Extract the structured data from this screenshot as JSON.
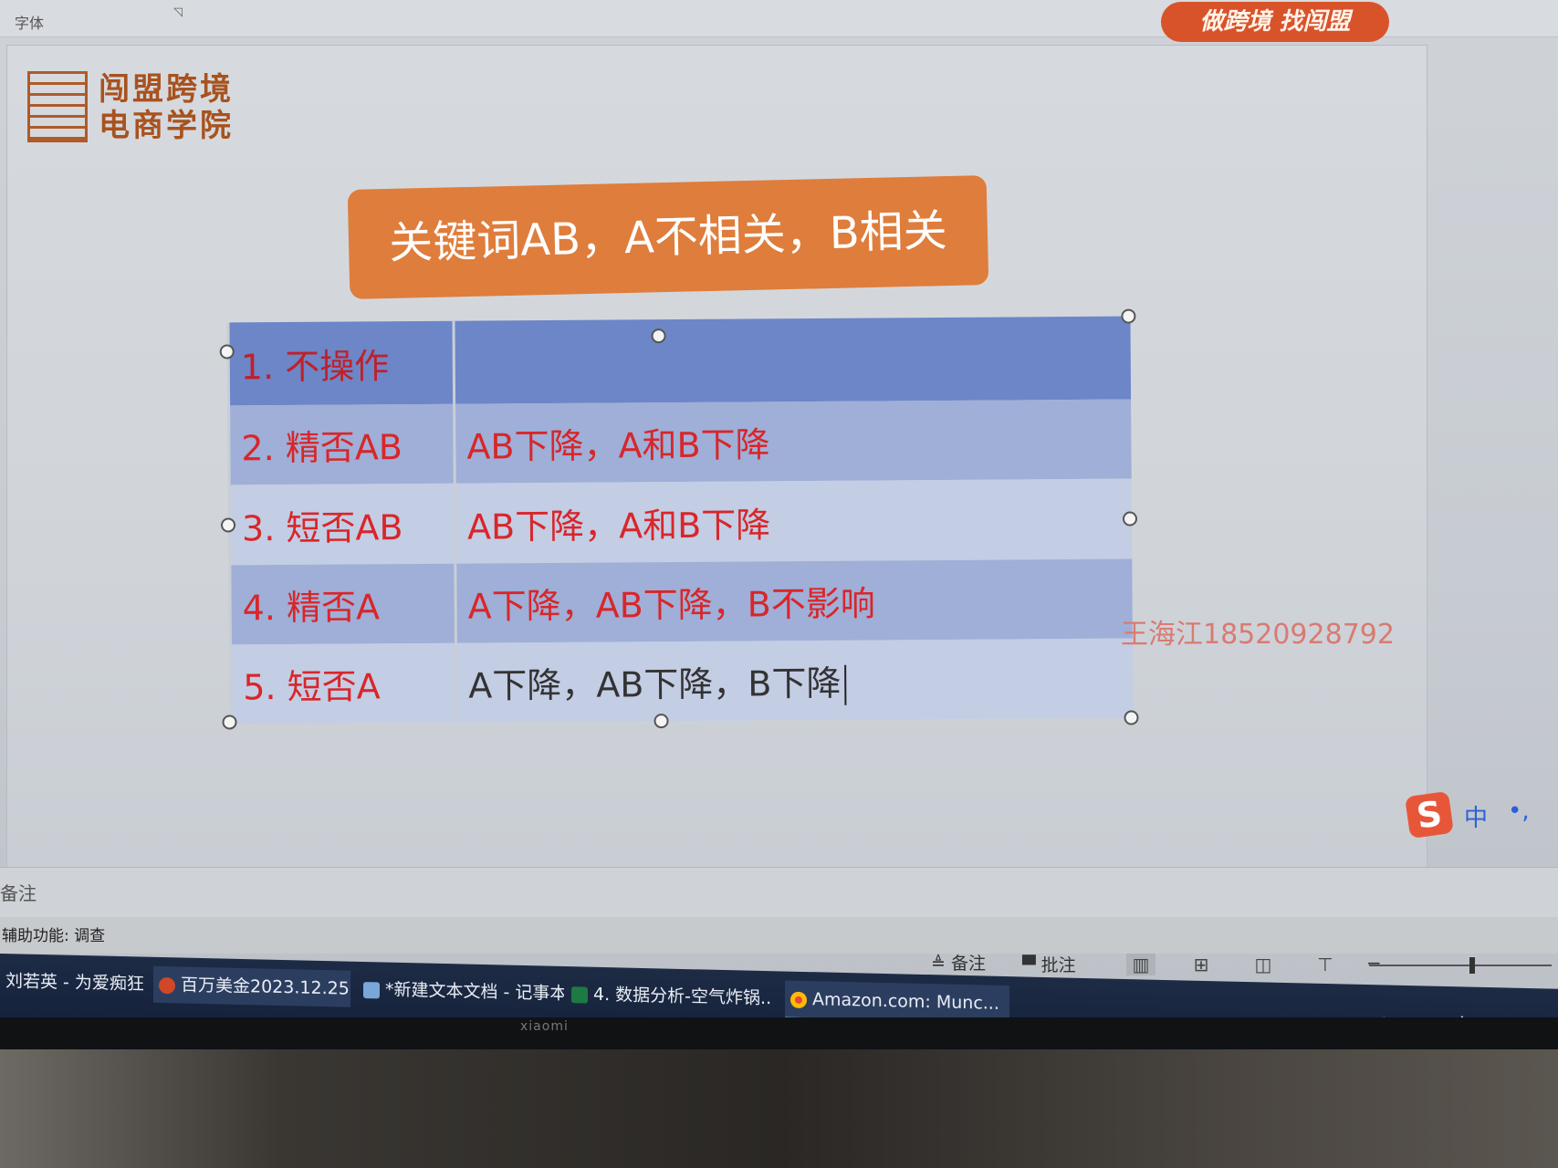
{
  "ribbon": {
    "font_group_label": "字体",
    "launcher_icon": "dialog-launcher-icon"
  },
  "slide": {
    "logo_text_line1": "闯盟跨境",
    "logo_text_line2": "电商学院",
    "brand_badge": "做跨境 找闯盟",
    "title": "关键词AB，A不相关，B相关",
    "table": {
      "rows": [
        {
          "a": "1. 不操作",
          "b": ""
        },
        {
          "a": "2. 精否AB",
          "b": "AB下降，A和B下降"
        },
        {
          "a": "3. 短否AB",
          "b": "AB下降，A和B下降"
        },
        {
          "a": "4. 精否A",
          "b": "A下降，AB下降，B不影响"
        },
        {
          "a": "5. 短否A",
          "b": "A下降，AB下降，B下降"
        }
      ]
    },
    "watermark": "王海江18520928792"
  },
  "notes": {
    "label": "备注"
  },
  "statusbar": {
    "accessibility": "辅助功能: 调查",
    "notes_button": "≜ 备注",
    "comments_button": "批注"
  },
  "taskbar": {
    "items": [
      "刘若英 - 为爱痴狂 ...",
      "百万美金2023.12.25 ...",
      "*新建文本文档 - 记事本",
      "4. 数据分析-空气炸锅...",
      "Amazon.com: Munc..."
    ],
    "tray_ime": "中"
  },
  "ime": {
    "mode": "中",
    "punct": "•,"
  },
  "bezel_brand": "xiaomi"
}
